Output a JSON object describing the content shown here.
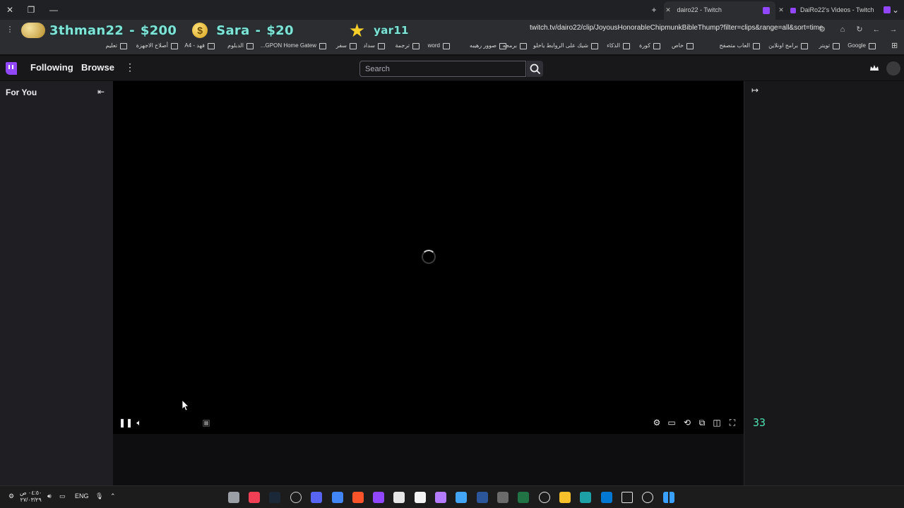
{
  "browser": {
    "tabs": [
      {
        "title": "dairo22 - Twitch",
        "active": true
      },
      {
        "title": "DaiRo22's Videos - Twitch",
        "active": false
      }
    ],
    "new_tab_label": "+",
    "url": "twitch.tv/dairo22/clip/JoyousHonorableChipmunkBibleThump?filter=clips&range=all&sort=time",
    "bookmarks": [
      "Google",
      "تويتر",
      "برامج اونلاين",
      "العاب متصفح",
      "خاص",
      "كورة",
      "الذكاء",
      "شيك على الروابط ياخلو",
      "برمجه",
      "صوور رهيبه",
      "word",
      "ترجمة",
      "سداد",
      "سفر",
      "GPON Home Gatew...",
      "الدبلوم",
      "فهد - A4",
      "أصلاح الاجهزة",
      "تعليم"
    ]
  },
  "donations": [
    {
      "name": "3thman22",
      "amount": "$200",
      "icon": "coin-icon"
    },
    {
      "name": "Sara",
      "amount": "$20",
      "icon": "dollar-coin-icon"
    },
    {
      "name": "yar11",
      "amount": "",
      "icon": "star-icon"
    }
  ],
  "twitch": {
    "nav": {
      "following": "Following",
      "browse": "Browse"
    },
    "search": {
      "placeholder": "Search"
    },
    "sidebar": {
      "title": "For You"
    },
    "player": {
      "state": "loading"
    },
    "counter": "33"
  },
  "taskbar": {
    "language": "ENG",
    "time": "٠٤:٥٠ ص",
    "date": "٢٧/٠٣/٢٩"
  },
  "colors": {
    "twitch_purple": "#9146ff",
    "counter_green": "#4ee0b0",
    "donation_text": "#7fe3d6"
  }
}
